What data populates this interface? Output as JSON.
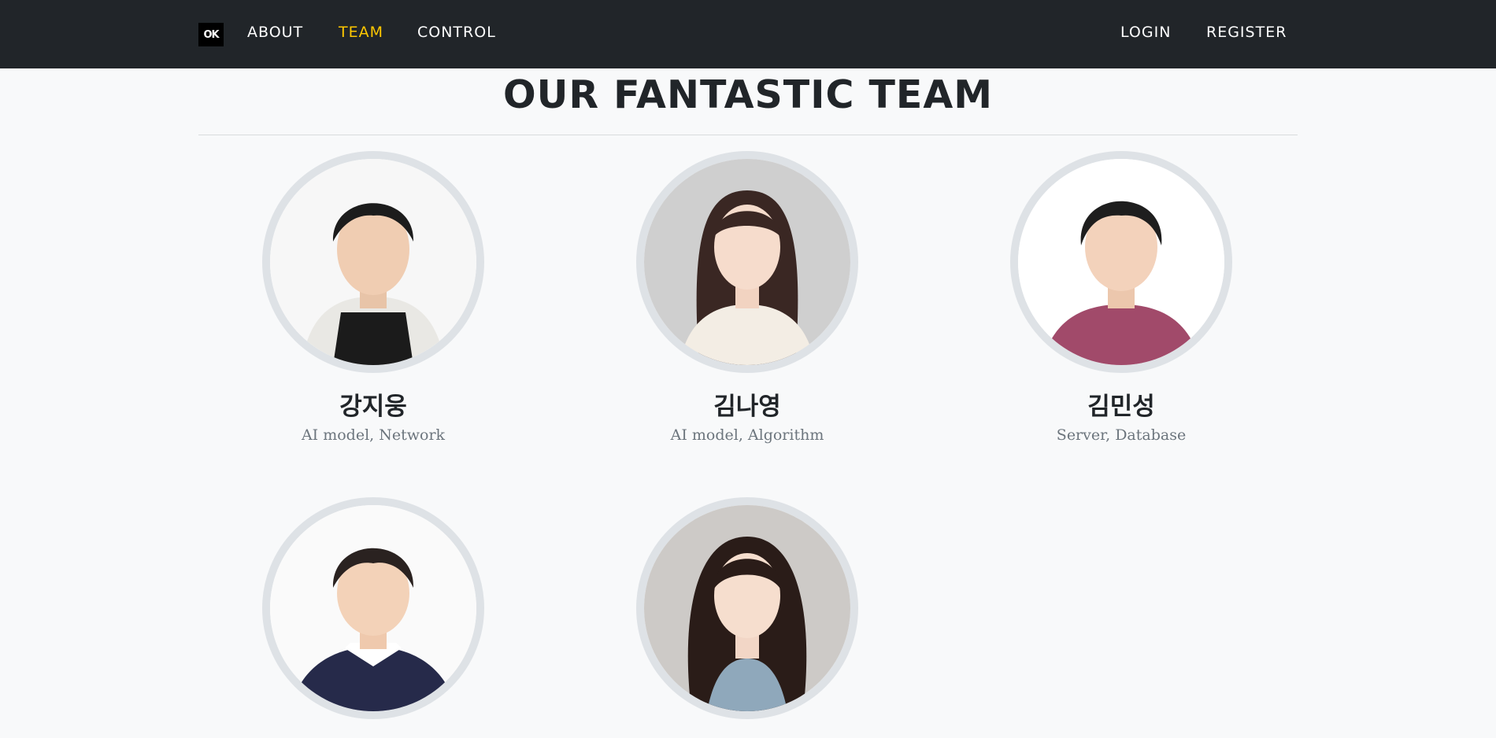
{
  "nav": {
    "brand_label": "OK",
    "links": [
      {
        "label": "ABOUT"
      },
      {
        "label": "TEAM"
      },
      {
        "label": "CONTROL"
      }
    ],
    "login_label": "LOGIN",
    "register_label": "REGISTER",
    "active_color": "#ffc800",
    "background": "#212529"
  },
  "team": {
    "heading": "OUR FANTASTIC TEAM",
    "members": [
      {
        "name": "강지웅",
        "role": "AI model, Network"
      },
      {
        "name": "김나영",
        "role": "AI model, Algorithm"
      },
      {
        "name": "김민성",
        "role": "Server, Database"
      },
      {
        "name": "",
        "role": ""
      },
      {
        "name": "",
        "role": ""
      }
    ]
  }
}
